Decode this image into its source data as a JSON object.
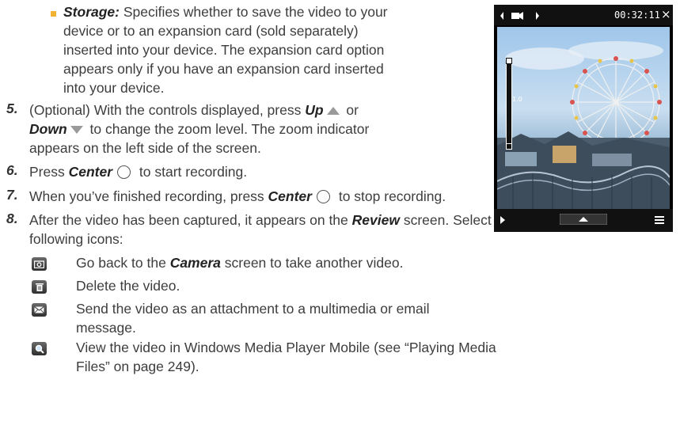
{
  "storage_bullet": {
    "label": "Storage:",
    "line1_rest": " Specifies whether to save the video to your",
    "lines": [
      "device or to an expansion card (sold separately)",
      "inserted into your device. The expansion card option",
      "appears only if you have an expansion card inserted",
      "into your device."
    ]
  },
  "steps": [
    {
      "number": "5.",
      "pre": "(Optional) With the controls displayed, press ",
      "up": "Up",
      "or": " or",
      "down": "Down",
      "line2_rest": " to change the zoom level. The zoom indicator",
      "line3": "appears on the left side of the screen."
    },
    {
      "number": "6.",
      "pre": "Press ",
      "key": "Center",
      "post": " to start recording."
    },
    {
      "number": "7.",
      "pre": "When you’ve finished recording, press ",
      "key": "Center",
      "post": " to stop recording."
    },
    {
      "number": "8.",
      "pre": "After the video has been captured, it appears on the ",
      "key": "Review",
      "post": " screen. Select one of the",
      "line2": "following icons:"
    }
  ],
  "icons": [
    {
      "icon": "camera-icon",
      "pre": "Go back to the ",
      "key": "Camera",
      "post": " screen to take another video."
    },
    {
      "icon": "trash-icon",
      "text": "Delete the video."
    },
    {
      "icon": "envelope-icon",
      "line1": "Send the video as an attachment to a multimedia or email",
      "line2": "message."
    },
    {
      "icon": "magnifier-icon",
      "line1": "View the video in Windows Media Player Mobile (see “Playing Media",
      "line2": "Files” on page 249)."
    }
  ],
  "phone": {
    "time": "00:32:11",
    "close": "×",
    "zoom_indicator": "1.0"
  },
  "colors": {
    "bullet": "#f2b233",
    "text": "#3d3d3d",
    "arrow": "#9a9a9a"
  }
}
